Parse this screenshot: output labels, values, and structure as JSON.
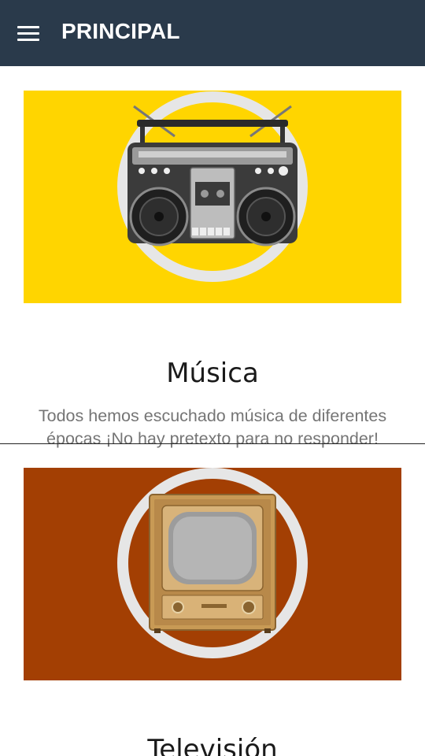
{
  "appbar": {
    "title": "PRINCIPAL",
    "menu_icon": "hamburger-menu-icon",
    "background": "#2a3a4b"
  },
  "categories": [
    {
      "title": "Música",
      "description": "Todos hemos escuchado música de diferentes épocas ¡No hay pretexto para no responder!",
      "image": "boombox-icon",
      "image_background": "#ffd500"
    },
    {
      "title": "Televisión",
      "image": "retro-television-icon",
      "image_background": "#a33f03"
    }
  ]
}
